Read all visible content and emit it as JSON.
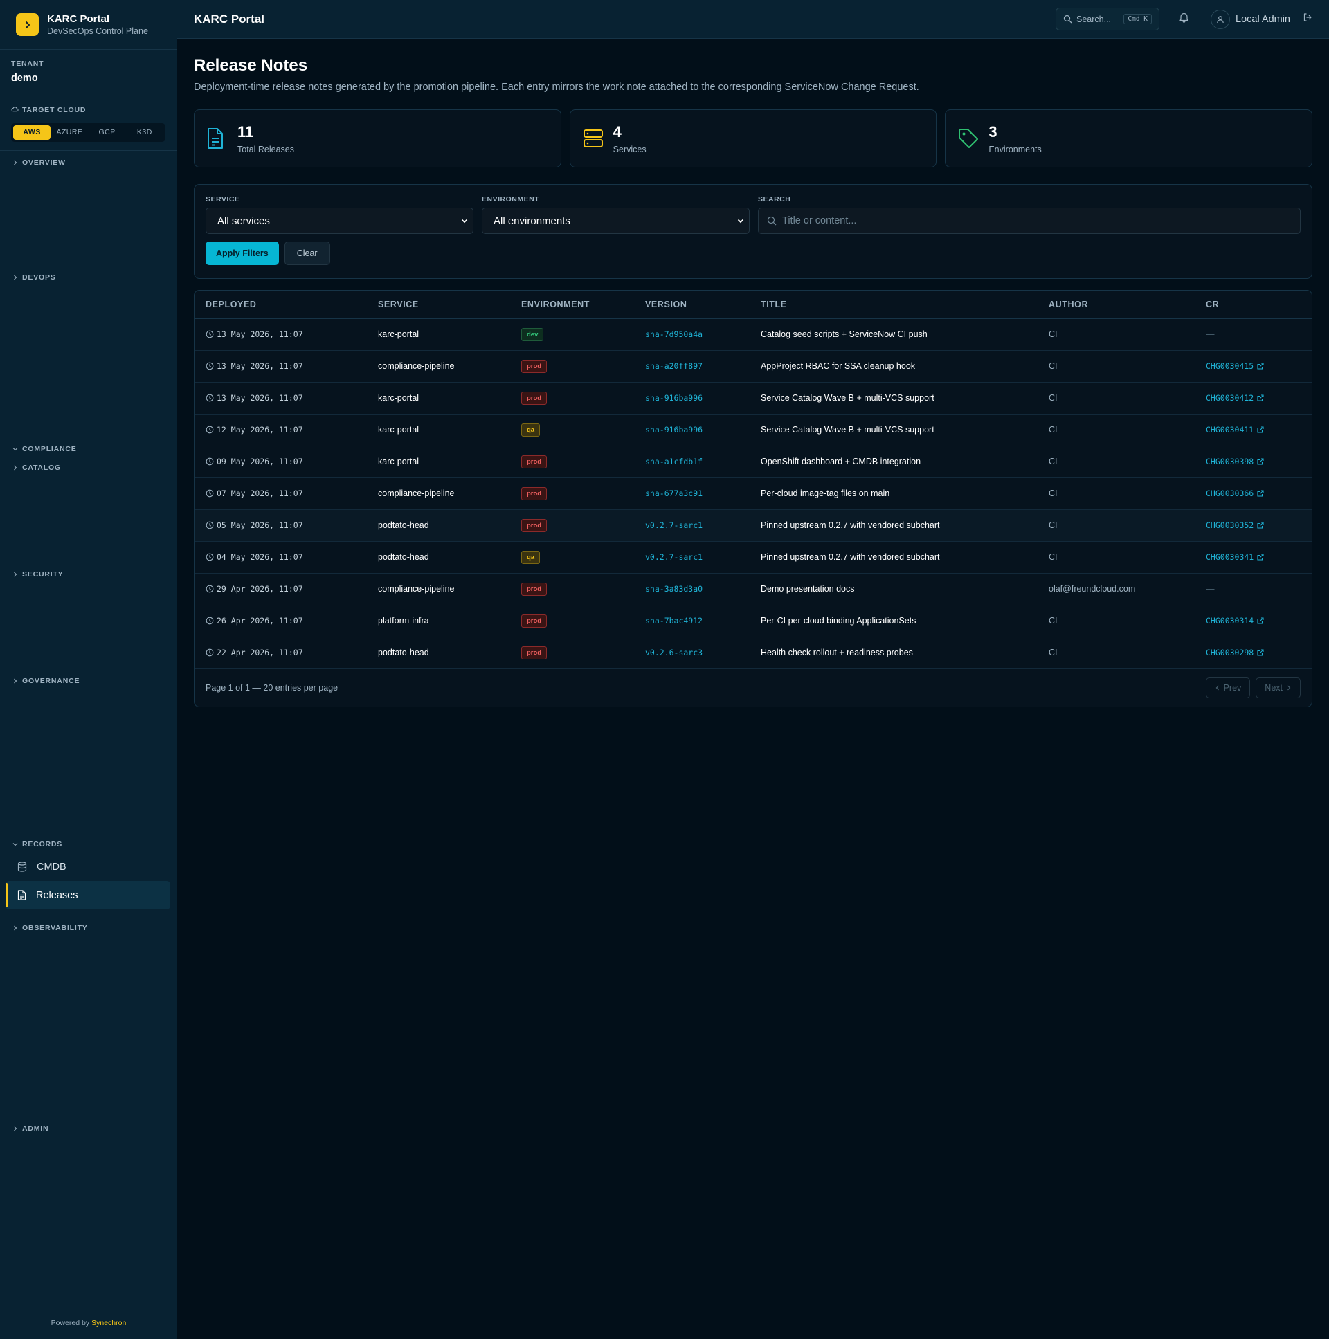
{
  "brand": {
    "title": "KARC Portal",
    "subtitle": "DevSecOps Control Plane"
  },
  "tenant": {
    "label": "TENANT",
    "value": "demo"
  },
  "cloud": {
    "label": "TARGET CLOUD",
    "options": [
      "AWS",
      "AZURE",
      "GCP",
      "K3D"
    ],
    "selected": "AWS"
  },
  "nav": {
    "sections": {
      "overview": "OVERVIEW",
      "devops": "DEVOPS",
      "compliance": "COMPLIANCE",
      "catalog": "CATALOG",
      "security": "SECURITY",
      "governance": "GOVERNANCE",
      "records": "RECORDS",
      "observability": "OBSERVABILITY",
      "admin": "ADMIN"
    },
    "items": {
      "cmdb": "CMDB",
      "releases": "Releases"
    },
    "active": "Releases"
  },
  "footer": {
    "prefix": "Powered by",
    "brand": "Synechron"
  },
  "topbar": {
    "title": "KARC Portal",
    "search_label": "Search...",
    "shortcut": "Cmd K",
    "user": "Local Admin"
  },
  "page": {
    "title": "Release Notes",
    "subtitle": "Deployment-time release notes generated by the promotion pipeline. Each entry mirrors the work note attached to the corresponding ServiceNow Change Request."
  },
  "stats": [
    {
      "value": "11",
      "label": "Total Releases",
      "icon": "file-text-icon"
    },
    {
      "value": "4",
      "label": "Services",
      "icon": "server-icon"
    },
    {
      "value": "3",
      "label": "Environments",
      "icon": "tag-icon"
    }
  ],
  "filters": {
    "service_label": "SERVICE",
    "service_value": "All services",
    "env_label": "ENVIRONMENT",
    "env_value": "All environments",
    "search_label": "SEARCH",
    "search_placeholder": "Title or content...",
    "apply": "Apply Filters",
    "clear": "Clear"
  },
  "table": {
    "headers": [
      "DEPLOYED",
      "SERVICE",
      "ENVIRONMENT",
      "VERSION",
      "TITLE",
      "AUTHOR",
      "CR"
    ],
    "rows": [
      {
        "deployed": "13 May 2026, 11:07",
        "service": "karc-portal",
        "env": "dev",
        "version": "sha-7d950a4a",
        "title": "Catalog seed scripts + ServiceNow CI push",
        "author": "CI",
        "cr": "—"
      },
      {
        "deployed": "13 May 2026, 11:07",
        "service": "compliance-pipeline",
        "env": "prod",
        "version": "sha-a20ff897",
        "title": "AppProject RBAC for SSA cleanup hook",
        "author": "CI",
        "cr": "CHG0030415"
      },
      {
        "deployed": "13 May 2026, 11:07",
        "service": "karc-portal",
        "env": "prod",
        "version": "sha-916ba996",
        "title": "Service Catalog Wave B + multi-VCS support",
        "author": "CI",
        "cr": "CHG0030412"
      },
      {
        "deployed": "12 May 2026, 11:07",
        "service": "karc-portal",
        "env": "qa",
        "version": "sha-916ba996",
        "title": "Service Catalog Wave B + multi-VCS support",
        "author": "CI",
        "cr": "CHG0030411"
      },
      {
        "deployed": "09 May 2026, 11:07",
        "service": "karc-portal",
        "env": "prod",
        "version": "sha-a1cfdb1f",
        "title": "OpenShift dashboard + CMDB integration",
        "author": "CI",
        "cr": "CHG0030398"
      },
      {
        "deployed": "07 May 2026, 11:07",
        "service": "compliance-pipeline",
        "env": "prod",
        "version": "sha-677a3c91",
        "title": "Per-cloud image-tag files on main",
        "author": "CI",
        "cr": "CHG0030366"
      },
      {
        "deployed": "05 May 2026, 11:07",
        "service": "podtato-head",
        "env": "prod",
        "version": "v0.2.7-sarc1",
        "title": "Pinned upstream 0.2.7 with vendored subchart",
        "author": "CI",
        "cr": "CHG0030352"
      },
      {
        "deployed": "04 May 2026, 11:07",
        "service": "podtato-head",
        "env": "qa",
        "version": "v0.2.7-sarc1",
        "title": "Pinned upstream 0.2.7 with vendored subchart",
        "author": "CI",
        "cr": "CHG0030341"
      },
      {
        "deployed": "29 Apr 2026, 11:07",
        "service": "compliance-pipeline",
        "env": "prod",
        "version": "sha-3a83d3a0",
        "title": "Demo presentation docs",
        "author": "olaf@freundcloud.com",
        "cr": "—"
      },
      {
        "deployed": "26 Apr 2026, 11:07",
        "service": "platform-infra",
        "env": "prod",
        "version": "sha-7bac4912",
        "title": "Per-CI per-cloud binding ApplicationSets",
        "author": "CI",
        "cr": "CHG0030314"
      },
      {
        "deployed": "22 Apr 2026, 11:07",
        "service": "podtato-head",
        "env": "prod",
        "version": "v0.2.6-sarc3",
        "title": "Health check rollout + readiness probes",
        "author": "CI",
        "cr": "CHG0030298"
      }
    ],
    "pagination": "Page 1 of 1 — 20 entries per page",
    "prev": "Prev",
    "next": "Next"
  },
  "colors": {
    "accent": "#f5c518",
    "link": "#1fb3d6",
    "primary_button": "#06b6d4",
    "prod": "#ef6060",
    "dev": "#34c77b",
    "qa": "#f5c518"
  }
}
